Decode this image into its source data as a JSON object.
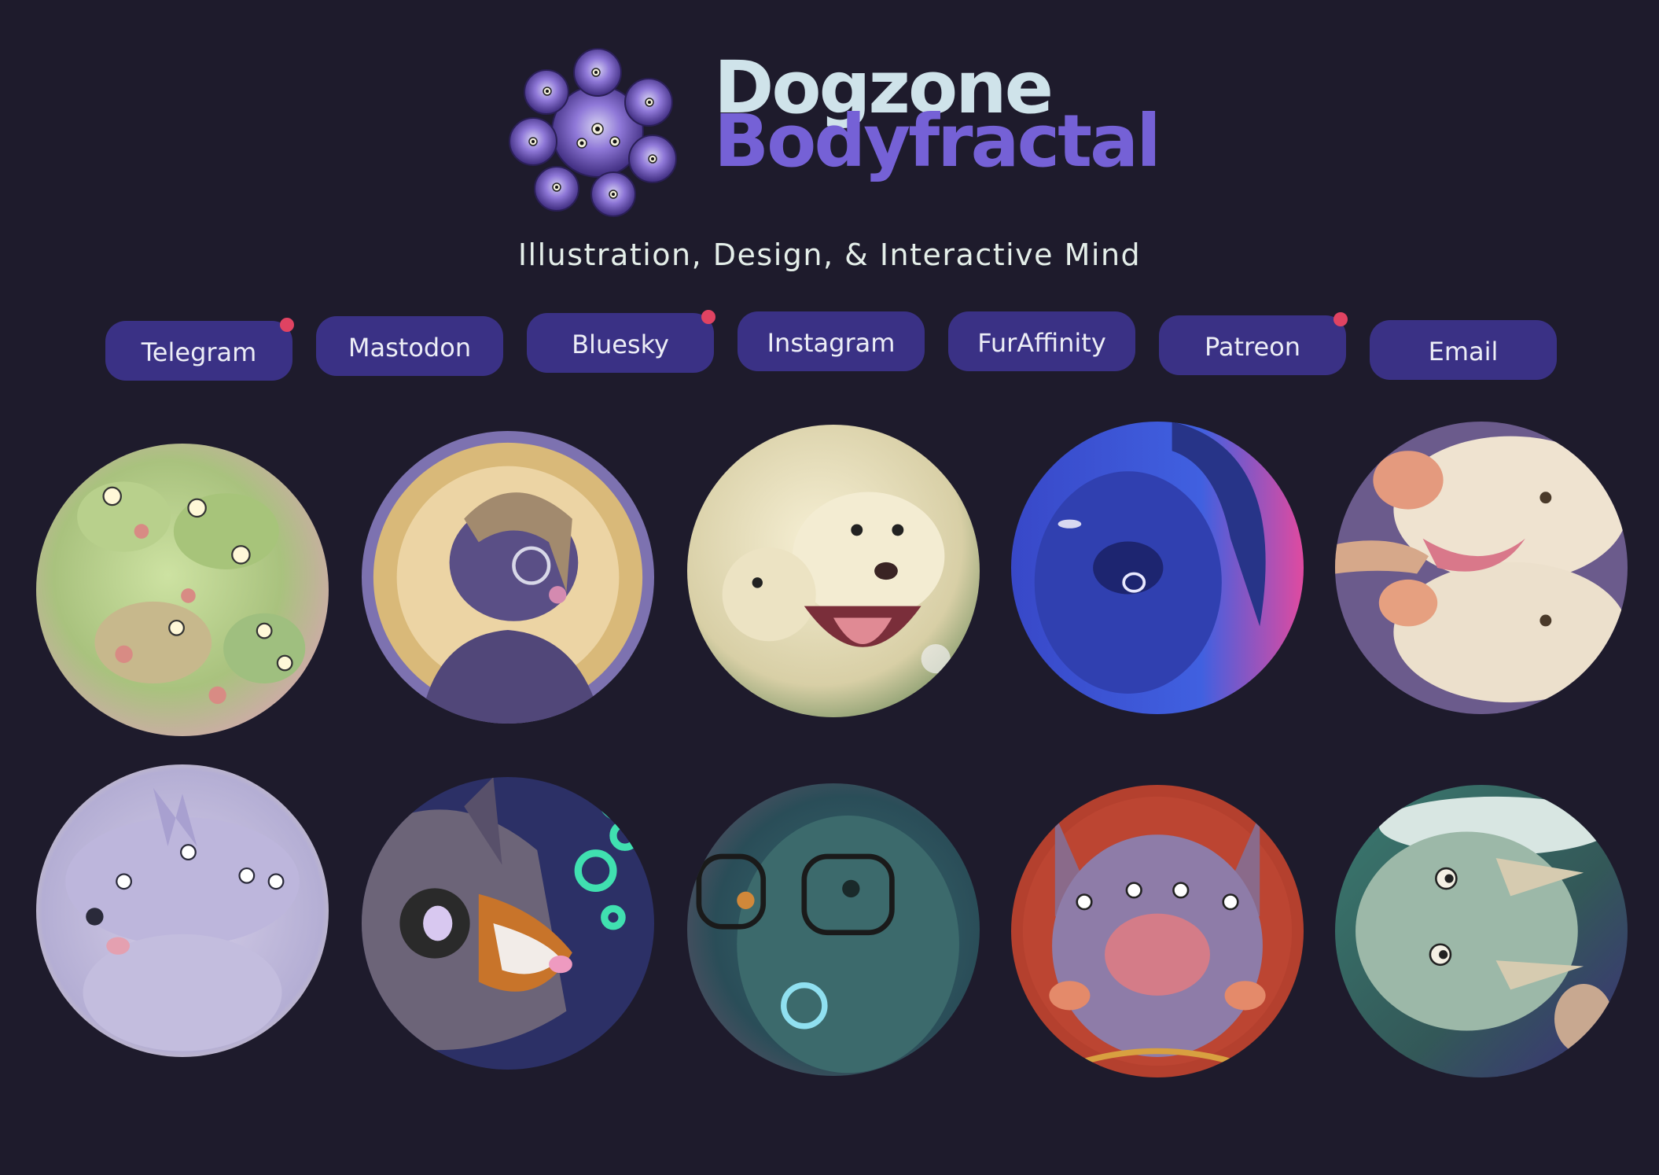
{
  "header": {
    "logo_line1": "Dogzone",
    "logo_line2": "Bodyfractal",
    "tagline": "Illustration, Design, & Interactive Mind"
  },
  "nav": [
    {
      "label": "Telegram",
      "notification": true
    },
    {
      "label": "Mastodon",
      "notification": false
    },
    {
      "label": "Bluesky",
      "notification": true
    },
    {
      "label": "Instagram",
      "notification": false
    },
    {
      "label": "FurAffinity",
      "notification": false
    },
    {
      "label": "Patreon",
      "notification": true
    },
    {
      "label": "Email",
      "notification": false
    }
  ],
  "colors": {
    "background": "#1e1b2c",
    "button": "#3a3185",
    "button_text": "#ecedf6",
    "notification_dot": "#e04362",
    "logo_light": "#cfe3ea",
    "logo_purple": "#7561d6"
  },
  "gallery": [
    {
      "art": "green-multi-headed-dog-art"
    },
    {
      "art": "glasses-sweater-dog-portrait-art"
    },
    {
      "art": "white-fluffy-two-headed-dog-art"
    },
    {
      "art": "blue-face-septum-ring-art"
    },
    {
      "art": "cream-dog-tongue-grab-art"
    },
    {
      "art": "lavender-many-eyed-dog-art"
    },
    {
      "art": "sheltie-dog-bubbles-art"
    },
    {
      "art": "teal-glasses-portrait-art"
    },
    {
      "art": "four-eyed-pink-dog-art"
    },
    {
      "art": "teal-stacked-face-creature-art"
    }
  ]
}
